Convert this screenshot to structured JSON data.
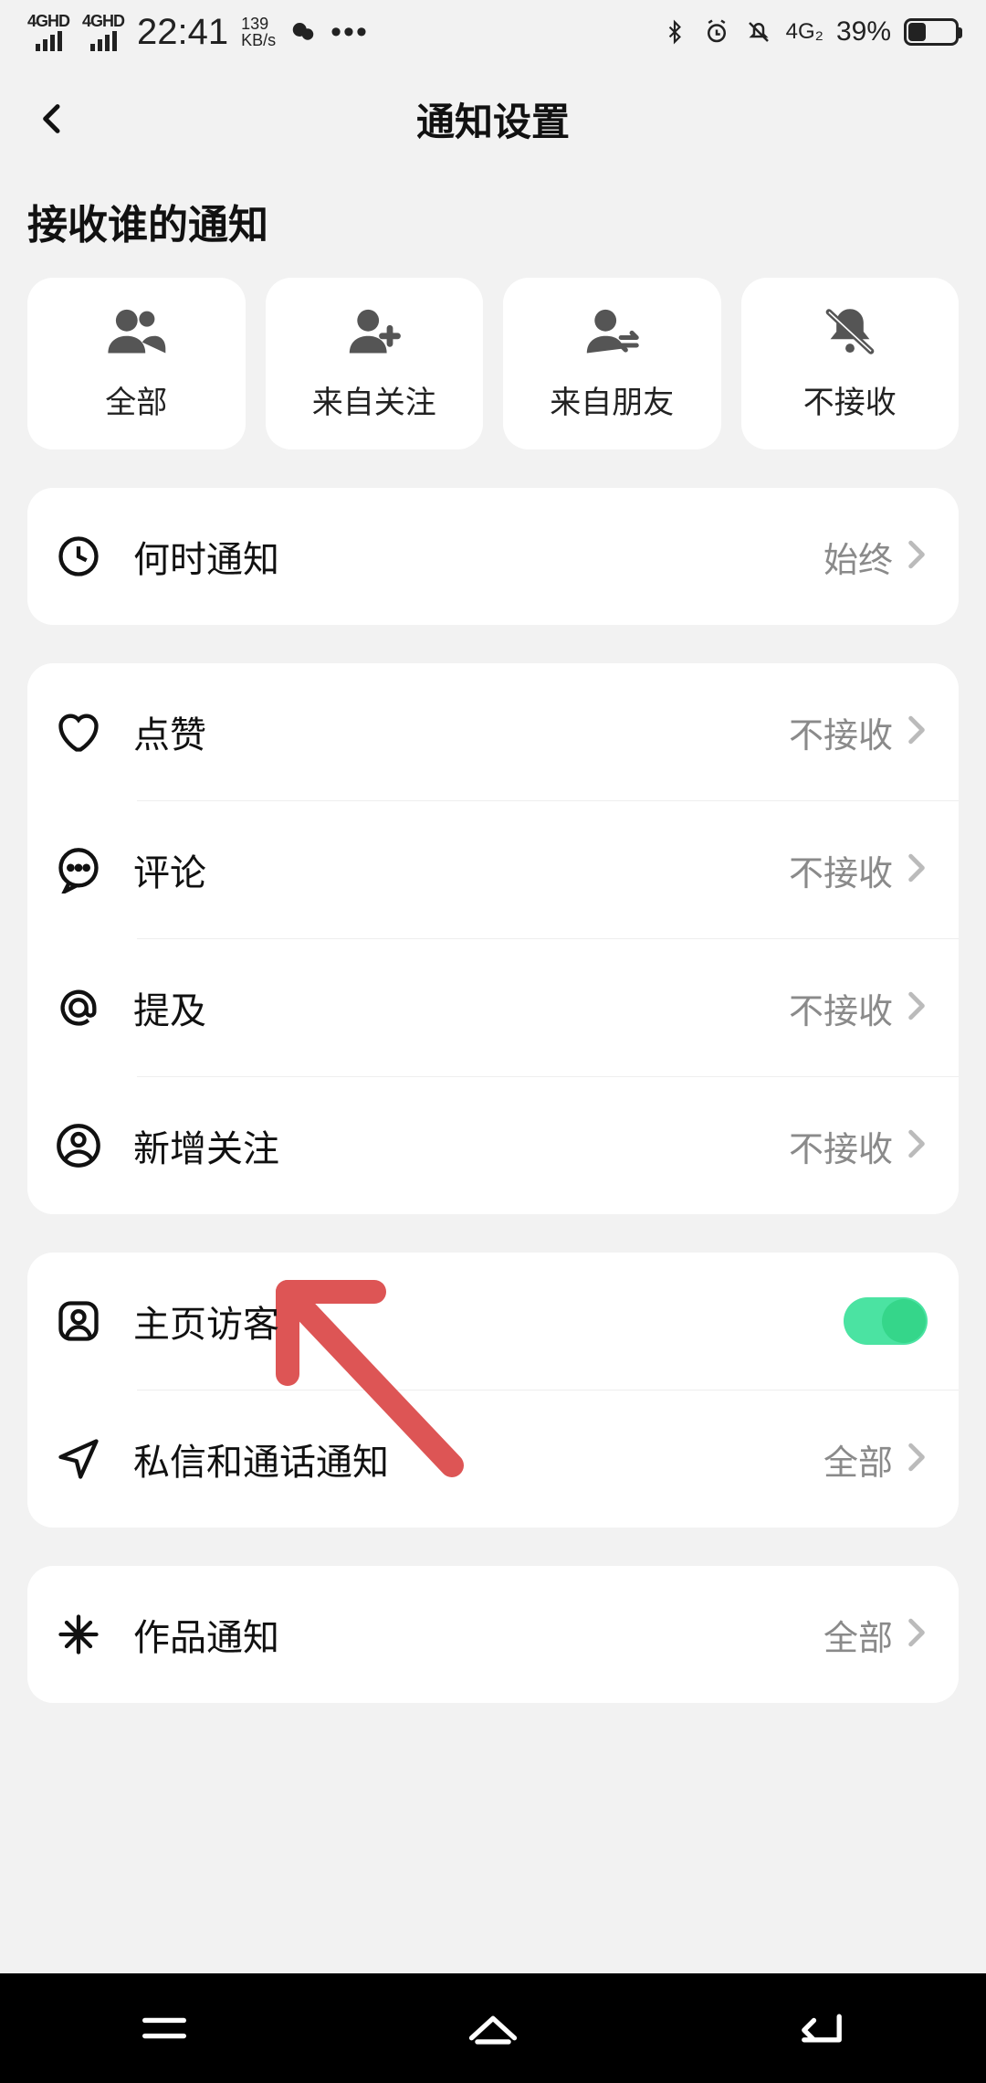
{
  "status": {
    "sig1": "4GHD",
    "sig2": "4GHD",
    "time": "22:41",
    "net_rate_num": "139",
    "net_rate_unit": "KB/s",
    "net_type": "4G₂",
    "battery_pct": "39%"
  },
  "header": {
    "title": "通知设置"
  },
  "section": {
    "heading": "接收谁的通知"
  },
  "filters": {
    "all": "全部",
    "from_follow": "来自关注",
    "from_friends": "来自朋友",
    "none": "不接收"
  },
  "rows": {
    "when": {
      "label": "何时通知",
      "value": "始终"
    },
    "like": {
      "label": "点赞",
      "value": "不接收"
    },
    "comment": {
      "label": "评论",
      "value": "不接收"
    },
    "mention": {
      "label": "提及",
      "value": "不接收"
    },
    "new_follower": {
      "label": "新增关注",
      "value": "不接收"
    },
    "visitor": {
      "label": "主页访客"
    },
    "dm": {
      "label": "私信和通话通知",
      "value": "全部"
    },
    "works": {
      "label": "作品通知",
      "value": "全部"
    }
  }
}
